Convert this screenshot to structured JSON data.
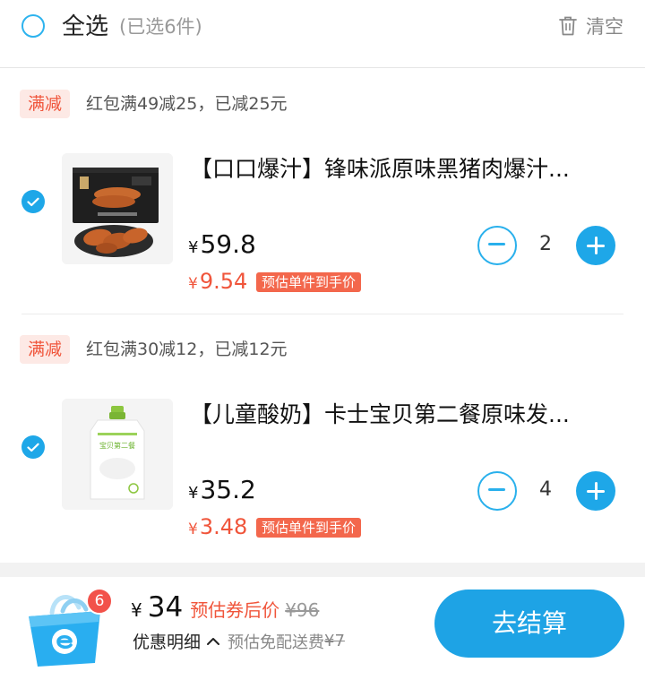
{
  "header": {
    "select_all_label": "全选",
    "selected_count_text": "(已选6件)",
    "clear_label": "清空",
    "clear_icon": "trash-icon"
  },
  "groups": [
    {
      "promo_badge": "满减",
      "promo_text": "红包满49减25，已减25元",
      "item": {
        "checked": true,
        "title": "【口口爆汁】锋味派原味黑猪肉爆汁...",
        "price_symbol": "¥",
        "price": "59.8",
        "estimated_symbol": "¥",
        "estimated_price": "9.54",
        "estimated_tag": "预估单件到手价",
        "quantity": "2",
        "image": "sausage-product-image"
      }
    },
    {
      "promo_badge": "满减",
      "promo_text": "红包满30减12，已减12元",
      "item": {
        "checked": true,
        "title": "【儿童酸奶】卡士宝贝第二餐原味发...",
        "price_symbol": "¥",
        "price": "35.2",
        "estimated_symbol": "¥",
        "estimated_price": "3.48",
        "estimated_tag": "预估单件到手价",
        "quantity": "4",
        "image": "yogurt-pouch-product-image"
      }
    }
  ],
  "footer": {
    "cart_badge_count": "6",
    "total_symbol": "¥",
    "total_value": "34",
    "coupon_label": "预估券后价",
    "original_price": "¥96",
    "detail_label": "优惠明细",
    "shipping_label": "预估免配送费",
    "shipping_price": "¥7",
    "checkout_label": "去结算"
  },
  "colors": {
    "accent_blue": "#1ea7e8",
    "promo_red": "#f0553b",
    "badge_red": "#f2524a"
  }
}
